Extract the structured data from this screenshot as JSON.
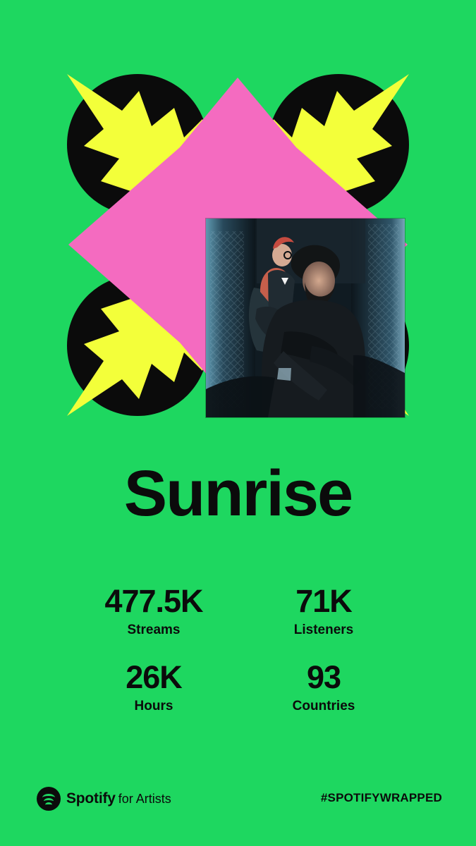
{
  "card": {
    "background_color": "#1ed760",
    "title": "Sunrise",
    "stats": [
      {
        "value": "477.5K",
        "label": "Streams"
      },
      {
        "value": "71K",
        "label": "Listeners"
      },
      {
        "value": "26K",
        "label": "Hours"
      },
      {
        "value": "93",
        "label": "Countries"
      }
    ],
    "footer": {
      "brand_name": "Spotify",
      "brand_suffix": "for Artists",
      "hashtag": "#SPOTIFYWRAPPED"
    }
  },
  "art": {
    "shapes": {
      "circle_color": "#0b0b0b",
      "burst_color": "#f3ff3a",
      "diamond_color": "#f46bc0"
    },
    "photo": {
      "subject": "two band members in a dim room"
    }
  },
  "icons": {
    "spotify_logo": "spotify-icon"
  }
}
